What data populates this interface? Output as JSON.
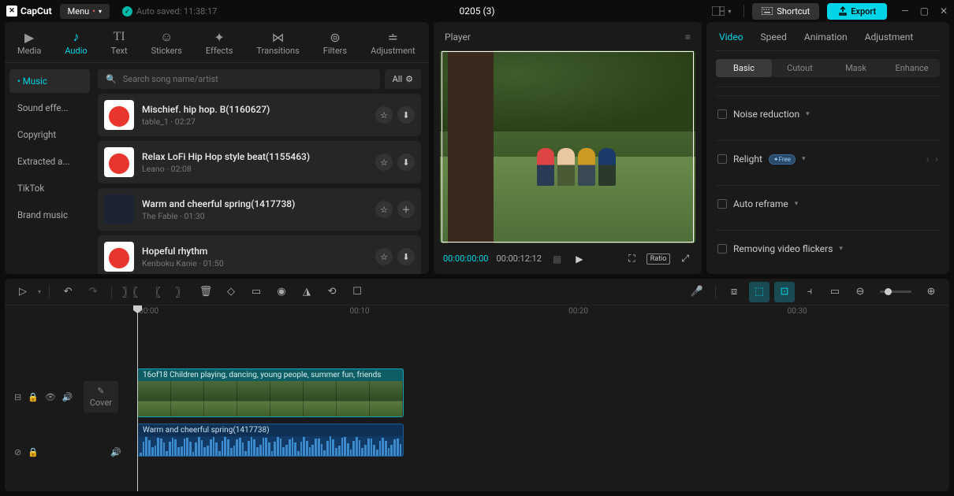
{
  "app": {
    "name": "CapCut"
  },
  "titlebar": {
    "menu": "Menu",
    "autosave": "Auto saved: 11:38:17",
    "project_title": "0205 (3)",
    "shortcut": "Shortcut",
    "export": "Export"
  },
  "media_tabs": [
    {
      "id": "media",
      "label": "Media"
    },
    {
      "id": "audio",
      "label": "Audio"
    },
    {
      "id": "text",
      "label": "Text"
    },
    {
      "id": "stickers",
      "label": "Stickers"
    },
    {
      "id": "effects",
      "label": "Effects"
    },
    {
      "id": "transitions",
      "label": "Transitions"
    },
    {
      "id": "filters",
      "label": "Filters"
    },
    {
      "id": "adjustment",
      "label": "Adjustment"
    }
  ],
  "media_active": "audio",
  "categories": [
    {
      "label": "Music",
      "active": true
    },
    {
      "label": "Sound effe..."
    },
    {
      "label": "Copyright"
    },
    {
      "label": "Extracted a..."
    },
    {
      "label": "TikTok"
    },
    {
      "label": "Brand music"
    }
  ],
  "search": {
    "placeholder": "Search song name/artist",
    "all": "All"
  },
  "tracks": [
    {
      "title": "Mischief. hip hop. B(1160627)",
      "sub": "table_1 · 02:27",
      "thumb": "red",
      "actions": [
        "star",
        "download"
      ]
    },
    {
      "title": "Relax LoFi Hip Hop style beat(1155463)",
      "sub": "Leano · 02:08",
      "thumb": "red",
      "actions": [
        "star",
        "download"
      ]
    },
    {
      "title": "Warm and cheerful spring(1417738)",
      "sub": "The Fable · 01:30",
      "thumb": "dark",
      "actions": [
        "star",
        "plus"
      ]
    },
    {
      "title": "Hopeful rhythm",
      "sub": "Kenboku Kanie · 01:50",
      "thumb": "red",
      "actions": [
        "star",
        "download"
      ]
    }
  ],
  "player": {
    "label": "Player",
    "time_current": "00:00:00:00",
    "time_duration": "00:00:12:12",
    "ratio_label": "Ratio"
  },
  "inspector": {
    "tabs": [
      "Video",
      "Speed",
      "Animation",
      "Adjustment"
    ],
    "active": "Video",
    "subtabs": [
      "Basic",
      "Cutout",
      "Mask",
      "Enhance"
    ],
    "sub_active": "Basic",
    "options": {
      "noise": "Noise reduction",
      "relight": "Relight",
      "relight_badge": "✦Free",
      "reframe": "Auto reframe",
      "flicker": "Removing video flickers"
    }
  },
  "ruler": {
    "t0": "00:00",
    "t1": "00:10",
    "t2": "00:20",
    "t3": "00:30"
  },
  "timeline": {
    "cover": "Cover",
    "video_clip_label": "16of18 Children playing, dancing, young people, summer fun, friends",
    "audio_clip_label": "Warm and cheerful spring(1417738)"
  }
}
